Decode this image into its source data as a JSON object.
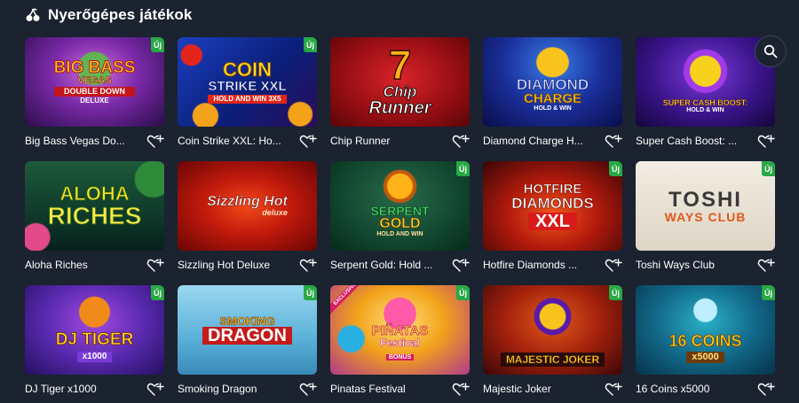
{
  "section": {
    "title": "Nyerőgépes játékok",
    "icon": "cherry-icon"
  },
  "search": {
    "icon": "search-icon"
  },
  "colors": {
    "background": "#1b2230",
    "new_badge": "#27a844",
    "exclusive_badge": "#d81b60"
  },
  "games": [
    {
      "title": "Big Bass Vegas Do...",
      "logo_lines": [
        "BIG BASS",
        "VEGAS",
        "DOUBLE DOWN",
        "DELUXE"
      ],
      "new": "Új",
      "exclusive": ""
    },
    {
      "title": "Coin Strike XXL: Ho...",
      "logo_lines": [
        "COIN",
        "STRIKE XXL",
        "HOLD AND WIN 3X5"
      ],
      "new": "Új",
      "exclusive": ""
    },
    {
      "title": "Chip Runner",
      "logo_lines": [
        "7",
        "Chip",
        "Runner"
      ],
      "new": "",
      "exclusive": ""
    },
    {
      "title": "Diamond Charge H...",
      "logo_lines": [
        "DIAMOND",
        "CHARGE",
        "HOLD & WIN"
      ],
      "new": "",
      "exclusive": ""
    },
    {
      "title": "Super Cash Boost: ...",
      "logo_lines": [
        "SUPER CASH BOOST:",
        "HOLD & WIN"
      ],
      "new": "",
      "exclusive": ""
    },
    {
      "title": "Aloha Riches",
      "logo_lines": [
        "ALOHA",
        "RICHES"
      ],
      "new": "",
      "exclusive": ""
    },
    {
      "title": "Sizzling Hot Deluxe",
      "logo_lines": [
        "Sizzling Hot",
        "deluxe"
      ],
      "new": "",
      "exclusive": ""
    },
    {
      "title": "Serpent Gold: Hold ...",
      "logo_lines": [
        "SERPENT",
        "GOLD",
        "HOLD AND WIN"
      ],
      "new": "Új",
      "exclusive": ""
    },
    {
      "title": "Hotfire Diamonds ...",
      "logo_lines": [
        "HOTFIRE",
        "DIAMONDS",
        "XXL"
      ],
      "new": "Új",
      "exclusive": ""
    },
    {
      "title": "Toshi Ways Club",
      "logo_lines": [
        "TOSHI",
        "WAYS CLUB"
      ],
      "new": "Új",
      "exclusive": ""
    },
    {
      "title": "DJ Tiger x1000",
      "logo_lines": [
        "DJ TIGER",
        "x1000"
      ],
      "new": "Új",
      "exclusive": ""
    },
    {
      "title": "Smoking Dragon",
      "logo_lines": [
        "SMOKING",
        "DRAGON"
      ],
      "new": "Új",
      "exclusive": ""
    },
    {
      "title": "Pinatas Festival",
      "logo_lines": [
        "PIÑATAS",
        "Festival",
        "BONUS"
      ],
      "new": "Új",
      "exclusive": "EXCLUSIVE"
    },
    {
      "title": "Majestic Joker",
      "logo_lines": [
        "MAJESTIC JOKER"
      ],
      "new": "Új",
      "exclusive": ""
    },
    {
      "title": "16 Coins x5000",
      "logo_lines": [
        "16 COINS",
        "x5000"
      ],
      "new": "Új",
      "exclusive": ""
    }
  ]
}
